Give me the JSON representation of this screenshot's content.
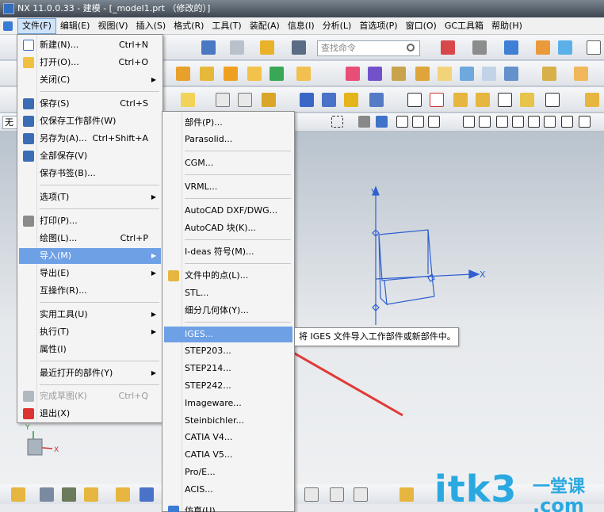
{
  "window": {
    "title": "NX 11.0.0.33 - 建模 - [_model1.prt （修改的）]"
  },
  "menubar": [
    "文件(F)",
    "编辑(E)",
    "视图(V)",
    "插入(S)",
    "格式(R)",
    "工具(T)",
    "装配(A)",
    "信息(I)",
    "分析(L)",
    "首选项(P)",
    "窗口(O)",
    "GC工具箱",
    "帮助(H)"
  ],
  "search": {
    "placeholder": "查找命令"
  },
  "selection_filter": "无过",
  "file_menu": {
    "new": {
      "label": "新建(N)...",
      "shortcut": "Ctrl+N"
    },
    "open": {
      "label": "打开(O)...",
      "shortcut": "Ctrl+O"
    },
    "close": {
      "label": "关闭(C)"
    },
    "save": {
      "label": "保存(S)",
      "shortcut": "Ctrl+S"
    },
    "save_work_part": {
      "label": "仅保存工作部件(W)"
    },
    "save_as": {
      "label": "另存为(A)...",
      "shortcut": "Ctrl+Shift+A"
    },
    "save_all": {
      "label": "全部保存(V)"
    },
    "save_bookmark": {
      "label": "保存书签(B)..."
    },
    "options": {
      "label": "选项(T)"
    },
    "print": {
      "label": "打印(P)..."
    },
    "plot": {
      "label": "绘图(L)...",
      "shortcut": "Ctrl+P"
    },
    "import": {
      "label": "导入(M)"
    },
    "export": {
      "label": "导出(E)"
    },
    "interop": {
      "label": "互操作(R)..."
    },
    "utilities": {
      "label": "实用工具(U)"
    },
    "execute": {
      "label": "执行(T)"
    },
    "properties": {
      "label": "属性(I)"
    },
    "recent": {
      "label": "最近打开的部件(Y)"
    },
    "finish_sketch": {
      "label": "完成草图(K)",
      "shortcut": "Ctrl+Q"
    },
    "exit": {
      "label": "退出(X)"
    }
  },
  "import_menu": {
    "part": "部件(P)...",
    "parasolid": "Parasolid...",
    "cgm": "CGM...",
    "vrml": "VRML...",
    "autocad_dxf": "AutoCAD DXF/DWG...",
    "autocad_block": "AutoCAD 块(K)...",
    "ideas": "I-deas 符号(M)...",
    "points": "文件中的点(L)...",
    "stl": "STL...",
    "faceted": "细分几何体(Y)...",
    "iges": "IGES...",
    "step203": "STEP203...",
    "step214": "STEP214...",
    "step242": "STEP242...",
    "imageware": "Imageware...",
    "steinbichler": "Steinbichler...",
    "catia_v4": "CATIA V4...",
    "catia_v5": "CATIA V5...",
    "proe": "Pro/E...",
    "acis": "ACIS...",
    "simulation": "仿真(U)"
  },
  "tooltip": "将 IGES 文件导入工作部件或新部件中。",
  "axes": {
    "x": "X",
    "y": "Y"
  },
  "watermark": {
    "text": "itk3",
    "sub1": "一堂课",
    "sub2": ".com"
  },
  "colors": {
    "highlight": "#6ea0e6",
    "watermark": "#2aa8e0",
    "axis": "#2f5fd0",
    "arrow": "#e03a36"
  }
}
